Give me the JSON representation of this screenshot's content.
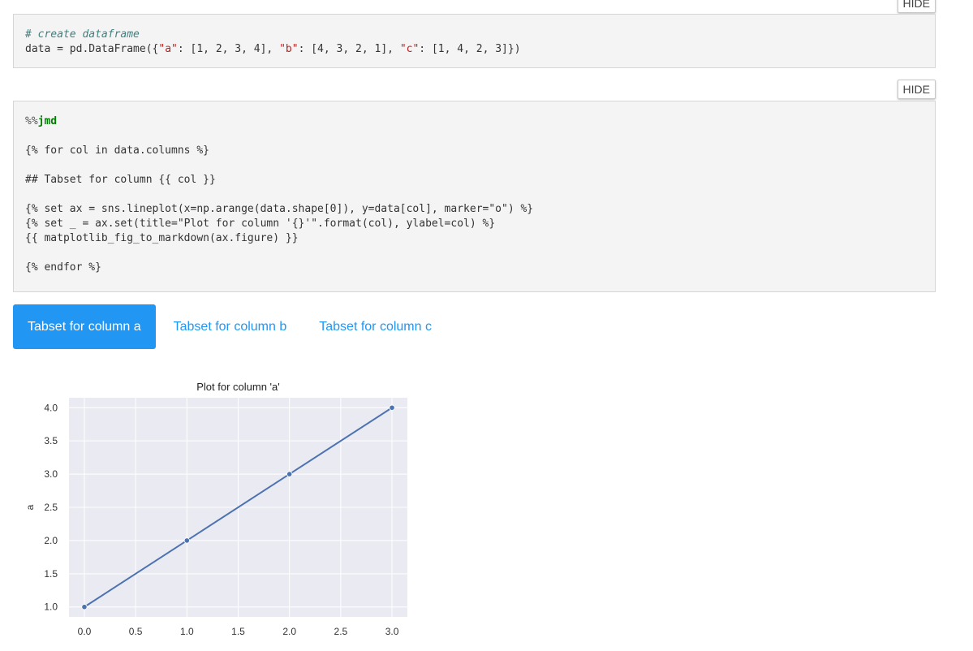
{
  "buttons": {
    "hide_top": "HIDE",
    "hide_second": "HIDE"
  },
  "cell1": {
    "comment": "# create dataframe",
    "code_prefix": "data = pd.DataFrame({",
    "key_a": "\"a\"",
    "vals_a": ": [1, 2, 3, 4], ",
    "key_b": "\"b\"",
    "vals_b": ": [4, 3, 2, 1], ",
    "key_c": "\"c\"",
    "vals_c": ": [1, 4, 2, 3]})"
  },
  "cell2": {
    "magic_prefix": "%%",
    "magic_name": "jmd",
    "line_for": "{% for col in data.columns %}",
    "line_heading": "## Tabset for column {{ col }}",
    "line_set_ax": "{% set ax = sns.lineplot(x=np.arange(data.shape[0]), y=data[col], marker=\"o\") %}",
    "line_set_title": "{% set _ = ax.set(title=\"Plot for column '{}'\".format(col), ylabel=col) %}",
    "line_fig": "{{ matplotlib_fig_to_markdown(ax.figure) }}",
    "line_endfor": "{% endfor %}"
  },
  "tabs": [
    {
      "label": "Tabset for column a",
      "active": true
    },
    {
      "label": "Tabset for column b",
      "active": false
    },
    {
      "label": "Tabset for column c",
      "active": false
    }
  ],
  "colors": {
    "accent": "#2196f3",
    "plot_bg": "#eaeaf2",
    "line": "#4c72b0"
  },
  "chart_data": {
    "type": "line",
    "title": "Plot for column 'a'",
    "xlabel": "",
    "ylabel": "a",
    "x": [
      0,
      1,
      2,
      3
    ],
    "series": [
      {
        "values": [
          1,
          2,
          3,
          4
        ]
      }
    ],
    "xticks": [
      "0.0",
      "0.5",
      "1.0",
      "1.5",
      "2.0",
      "2.5",
      "3.0"
    ],
    "yticks": [
      "1.0",
      "1.5",
      "2.0",
      "2.5",
      "3.0",
      "3.5",
      "4.0"
    ],
    "xlim": [
      -0.15,
      3.15
    ],
    "ylim": [
      0.85,
      4.15
    ],
    "grid": true,
    "marker": "o"
  }
}
